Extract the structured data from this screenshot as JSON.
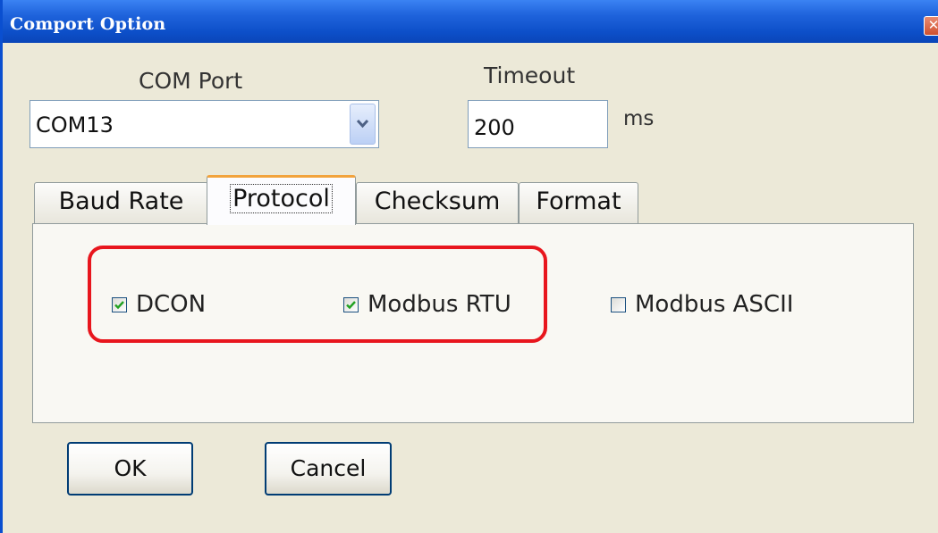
{
  "window": {
    "title": "Comport Option",
    "close_glyph": "✕"
  },
  "com_port": {
    "label": "COM Port",
    "value": "COM13"
  },
  "timeout": {
    "label": "Timeout",
    "value": "200",
    "unit": "ms"
  },
  "tabs": [
    {
      "label": "Baud Rate",
      "selected": false
    },
    {
      "label": "Protocol",
      "selected": true
    },
    {
      "label": "Checksum",
      "selected": false
    },
    {
      "label": "Format",
      "selected": false
    }
  ],
  "protocols": [
    {
      "label": "DCON",
      "checked": true
    },
    {
      "label": "Modbus RTU",
      "checked": true
    },
    {
      "label": "Modbus ASCII",
      "checked": false
    }
  ],
  "buttons": {
    "ok": "OK",
    "cancel": "Cancel"
  },
  "colors": {
    "titlebar": "#0a4fd0",
    "dialog_bg": "#ece9d8",
    "highlight": "#e8161d",
    "check_mark": "#21a121",
    "selected_tab_accent": "#f2a33c"
  },
  "icons": {
    "close": "close-icon",
    "dropdown": "chevron-down-icon",
    "check": "check-icon"
  }
}
